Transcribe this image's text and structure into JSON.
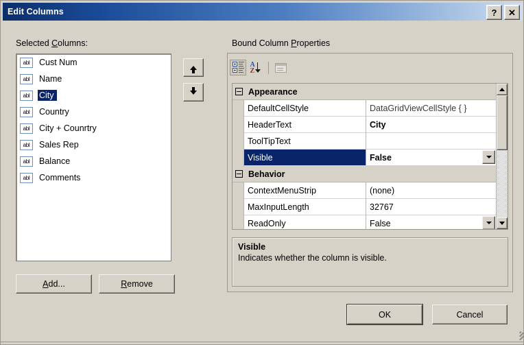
{
  "window": {
    "title": "Edit Columns",
    "help_button": "?",
    "close_button": "✕"
  },
  "left": {
    "label_prefix": "Selected ",
    "label_accel": "C",
    "label_suffix": "olumns:",
    "items": [
      {
        "icon": "abl",
        "label": "Cust Num",
        "selected": false
      },
      {
        "icon": "abl",
        "label": "Name",
        "selected": false
      },
      {
        "icon": "abl",
        "label": "City",
        "selected": true
      },
      {
        "icon": "abl",
        "label": "Country",
        "selected": false
      },
      {
        "icon": "abl",
        "label": "City + Counrtry",
        "selected": false
      },
      {
        "icon": "abl",
        "label": "Sales Rep",
        "selected": false
      },
      {
        "icon": "abl",
        "label": "Balance",
        "selected": false
      },
      {
        "icon": "abl",
        "label": "Comments",
        "selected": false
      }
    ],
    "move_up": "↑",
    "move_down": "↓",
    "add_prefix": "",
    "add_accel": "A",
    "add_suffix": "dd...",
    "remove_prefix": "",
    "remove_accel": "R",
    "remove_suffix": "emove"
  },
  "right": {
    "label_prefix": "Bound Column ",
    "label_accel": "P",
    "label_suffix": "roperties",
    "toolbar": {
      "categorized": "categorized-view-icon",
      "alphabetical": "alphabetical-sort-icon",
      "alphabetical_a": "A",
      "alphabetical_z": "Z",
      "property_pages": "property-pages-icon"
    },
    "grid": {
      "categories": [
        {
          "name": "Appearance",
          "rows": [
            {
              "name": "DefaultCellStyle",
              "value": "DataGridViewCellStyle { }",
              "bold": false,
              "dim": true,
              "selected": false,
              "dropdown": false
            },
            {
              "name": "HeaderText",
              "value": "City",
              "bold": true,
              "dim": false,
              "selected": false,
              "dropdown": false
            },
            {
              "name": "ToolTipText",
              "value": "",
              "bold": false,
              "dim": false,
              "selected": false,
              "dropdown": false
            },
            {
              "name": "Visible",
              "value": "False",
              "bold": true,
              "dim": false,
              "selected": true,
              "dropdown": true
            }
          ]
        },
        {
          "name": "Behavior",
          "rows": [
            {
              "name": "ContextMenuStrip",
              "value": "(none)",
              "bold": false,
              "dim": false,
              "selected": false,
              "dropdown": false
            },
            {
              "name": "MaxInputLength",
              "value": "32767",
              "bold": false,
              "dim": false,
              "selected": false,
              "dropdown": false
            },
            {
              "name": "ReadOnly",
              "value": "False",
              "bold": false,
              "dim": false,
              "selected": false,
              "dropdown": true
            }
          ]
        }
      ]
    },
    "description": {
      "title": "Visible",
      "text": "Indicates whether the column is visible."
    }
  },
  "footer": {
    "ok": "OK",
    "cancel": "Cancel"
  },
  "colors": {
    "title_bar_start": "#0b2e6b",
    "title_bar_end": "#cfdcf0",
    "dialog_face": "#d6d2c8",
    "selection": "#0a246a",
    "selection_text": "#ffffff",
    "grid_white": "#ffffff",
    "border": "#9b978e"
  }
}
